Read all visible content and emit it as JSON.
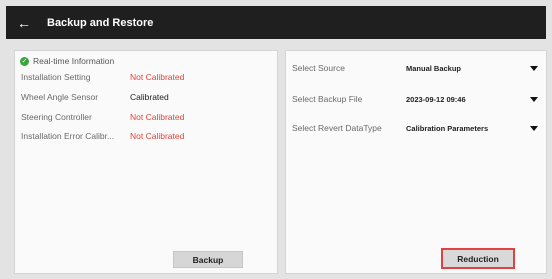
{
  "window": {
    "title": "Backup and Restore",
    "back_icon": "arrow-left-icon"
  },
  "left_panel": {
    "header": "Real-time Information",
    "header_icon": "check-circle-icon",
    "rows": [
      {
        "label": "Installation Setting",
        "value": "Not Calibrated"
      },
      {
        "label": "Wheel Angle Sensor",
        "value": "Calibrated"
      },
      {
        "label": "Steering Controller",
        "value": "Not Calibrated"
      },
      {
        "label": "Installation Error Calibr...",
        "value": "Not Calibrated"
      }
    ],
    "backup_label": "Backup"
  },
  "right_panel": {
    "selects": [
      {
        "label": "Select Source",
        "value": "Manual Backup"
      },
      {
        "label": "Select Backup File",
        "value": "2023-09-12 09:46"
      },
      {
        "label": "Select Revert DataType",
        "value": "Calibration Parameters"
      }
    ],
    "reduction_label": "Reduction"
  },
  "colors": {
    "title_bar": "#1f1f1f",
    "not_calibrated": "#e0443b",
    "ok_icon": "#3aa53a",
    "highlight_border": "#e04141"
  }
}
